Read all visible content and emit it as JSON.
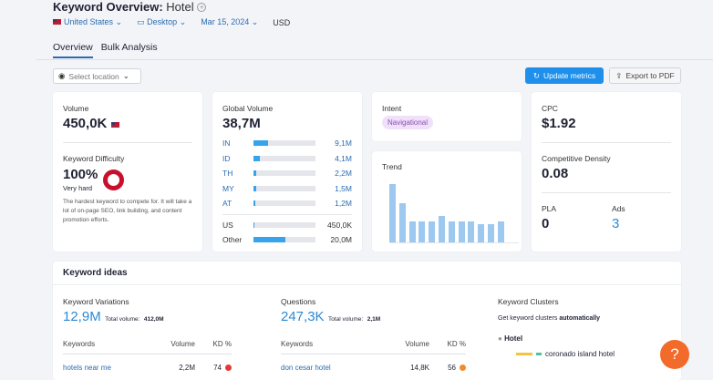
{
  "header": {
    "title": "Keyword Overview:",
    "keyword": "Hotel",
    "country": "United States",
    "device": "Desktop",
    "date": "Mar 15, 2024",
    "currency": "USD"
  },
  "tabs": [
    {
      "label": "Overview",
      "active": true
    },
    {
      "label": "Bulk Analysis",
      "active": false
    }
  ],
  "toolbar": {
    "location_placeholder": "Select location",
    "update_label": "Update metrics",
    "export_label": "Export to PDF"
  },
  "volume": {
    "label": "Volume",
    "value": "450,0K"
  },
  "kd": {
    "label": "Keyword Difficulty",
    "value": "100%",
    "level": "Very hard",
    "description": "The hardest keyword to compete for. It will take a lot of on-page SEO, link building, and content promotion efforts.",
    "percent": 100,
    "color": "#c8102e"
  },
  "global": {
    "label": "Global Volume",
    "value": "38,7M",
    "countries": [
      {
        "code": "IN",
        "value": "9,1M",
        "fraction": 0.23
      },
      {
        "code": "ID",
        "value": "4,1M",
        "fraction": 0.11
      },
      {
        "code": "TH",
        "value": "2,2M",
        "fraction": 0.05
      },
      {
        "code": "MY",
        "value": "1,5M",
        "fraction": 0.04
      },
      {
        "code": "AT",
        "value": "1,2M",
        "fraction": 0.03
      }
    ],
    "us": {
      "code": "US",
      "value": "450,0K",
      "fraction": 0.02
    },
    "other": {
      "code": "Other",
      "value": "20,0M",
      "fraction": 0.52
    }
  },
  "intent": {
    "label": "Intent",
    "value": "Navigational"
  },
  "trend": {
    "label": "Trend",
    "values": [
      100,
      67,
      36,
      36,
      36,
      45,
      36,
      36,
      36,
      31,
      31,
      36
    ]
  },
  "cpc": {
    "label": "CPC",
    "value": "$1.92"
  },
  "density": {
    "label": "Competitive Density",
    "value": "0.08"
  },
  "pla": {
    "label": "PLA",
    "value": "0"
  },
  "ads": {
    "label": "Ads",
    "value": "3"
  },
  "ideas": {
    "title": "Keyword ideas",
    "variations": {
      "label": "Keyword Variations",
      "value": "12,9M",
      "total_label": "Total volume:",
      "total": "412,0M",
      "cols": [
        "Keywords",
        "Volume",
        "KD %"
      ],
      "rows": [
        {
          "keyword": "hotels near me",
          "volume": "2,2M",
          "kd": "74",
          "color": "#e53935"
        }
      ]
    },
    "questions": {
      "label": "Questions",
      "value": "247,3K",
      "total_label": "Total volume:",
      "total": "2,1M",
      "cols": [
        "Keywords",
        "Volume",
        "KD %"
      ],
      "rows": [
        {
          "keyword": "don cesar hotel",
          "volume": "14,8K",
          "kd": "56",
          "color": "#f28c28"
        }
      ]
    },
    "clusters": {
      "label": "Keyword Clusters",
      "desc": "Get keyword clusters",
      "desc_bold": "automatically",
      "root": "Hotel",
      "child": "coronado island hotel"
    }
  },
  "help": {
    "label": "?"
  }
}
